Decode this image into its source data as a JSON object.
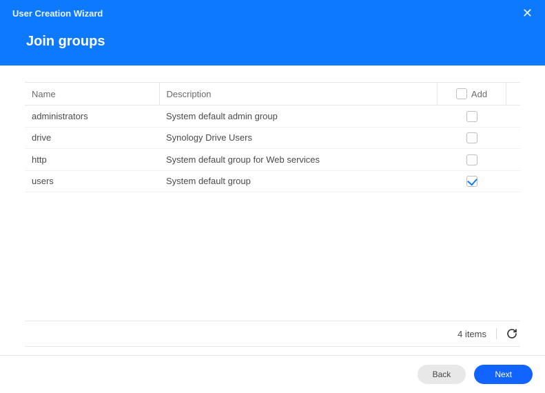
{
  "window": {
    "title": "User Creation Wizard",
    "page_title": "Join groups"
  },
  "table": {
    "headers": {
      "name": "Name",
      "description": "Description",
      "add": "Add"
    },
    "rows": [
      {
        "name": "administrators",
        "description": "System default admin group",
        "checked": false
      },
      {
        "name": "drive",
        "description": "Synology Drive Users",
        "checked": false
      },
      {
        "name": "http",
        "description": "System default group for Web services",
        "checked": false
      },
      {
        "name": "users",
        "description": "System default group",
        "checked": true
      }
    ]
  },
  "status": {
    "items_text": "4 items"
  },
  "buttons": {
    "back": "Back",
    "next": "Next"
  }
}
